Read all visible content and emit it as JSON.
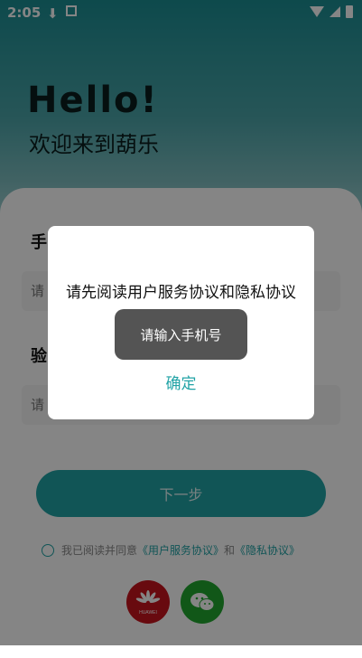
{
  "status_bar": {
    "time": "2:05",
    "left_icons": [
      "download-icon",
      "app-notification-icon"
    ],
    "right_icons": [
      "wifi-icon",
      "signal-icon",
      "battery-icon"
    ]
  },
  "header": {
    "hello": "Hello!",
    "welcome": "欢迎来到葫乐"
  },
  "form": {
    "phone_label": "手",
    "phone_placeholder": "请",
    "code_label": "验",
    "code_placeholder": "请",
    "next_label": "下一步"
  },
  "agreement": {
    "prefix": "我已阅读并同意",
    "user_agreement": "《用户服务协议》",
    "and": "和",
    "privacy": "《隐私协议》"
  },
  "social_login": {
    "huawei_label": "HUAWEI",
    "wechat_icon": "wechat-icon"
  },
  "dialog": {
    "message": "请先阅读用户服务协议和隐私协议",
    "confirm": "确定"
  },
  "toast": {
    "message": "请输入手机号"
  },
  "colors": {
    "accent": "#21a3a6",
    "hero_top": "#1b8e93",
    "huawei": "#c8151d",
    "wechat": "#21a82f"
  }
}
